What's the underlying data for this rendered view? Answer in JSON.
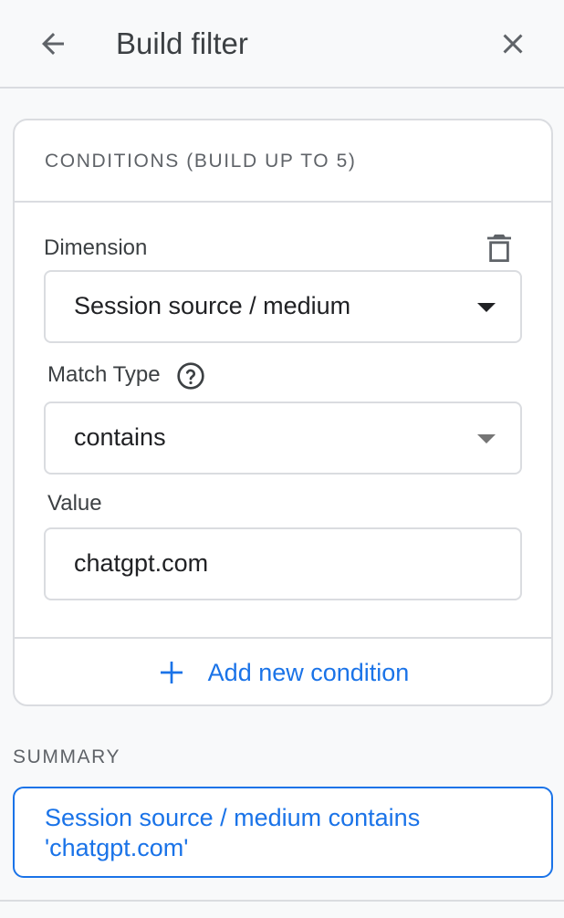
{
  "header": {
    "title": "Build filter",
    "back_icon": "arrow-back-icon",
    "close_icon": "close-icon"
  },
  "conditions": {
    "heading": "CONDITIONS (BUILD UP TO 5)",
    "dimension_label": "Dimension",
    "dimension_value": "Session source / medium",
    "match_type_label": "Match Type",
    "match_type_value": "contains",
    "value_label": "Value",
    "value_value": "chatgpt.com",
    "add_condition_label": "Add new condition",
    "delete_icon": "trash-icon",
    "help_icon": "help-circle-icon"
  },
  "summary": {
    "label": "SUMMARY",
    "text": "Session source / medium contains 'chatgpt.com'"
  },
  "colors": {
    "accent": "#1a73e8",
    "border": "#dadce0",
    "background": "#f8f9fa"
  }
}
